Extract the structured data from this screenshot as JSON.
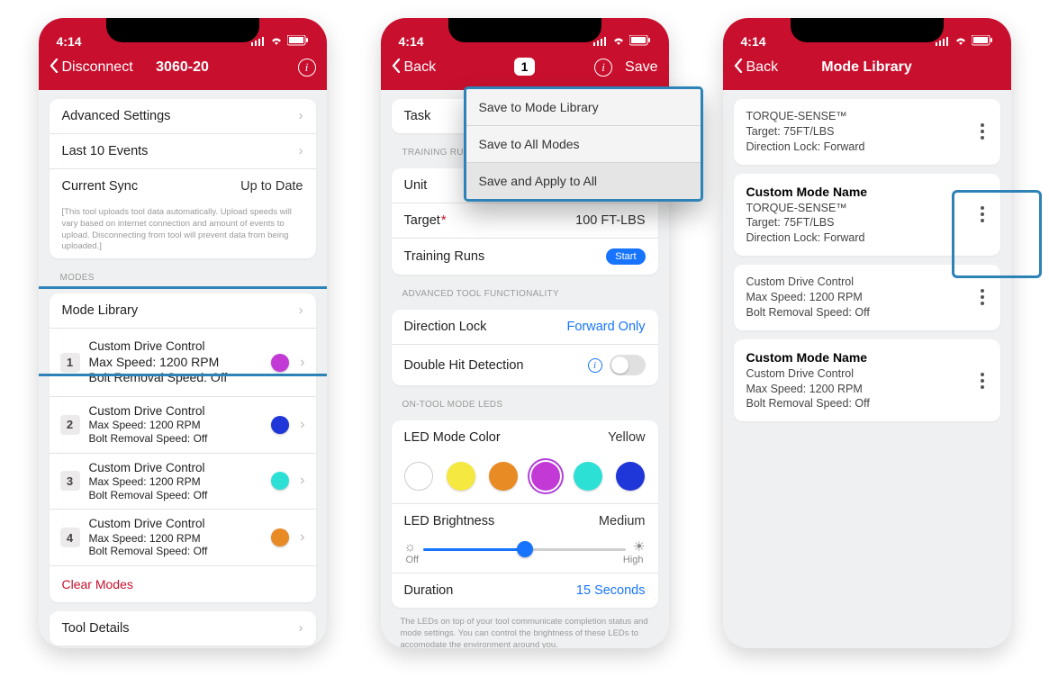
{
  "status_time": "4:14",
  "screen1": {
    "nav_left": "Disconnect",
    "nav_title": "3060-20",
    "rows": {
      "advanced": "Advanced Settings",
      "events": "Last 10 Events",
      "sync": "Current Sync",
      "sync_value": "Up to Date"
    },
    "fineprint": "[This tool uploads tool data automatically. Upload speeds will vary based on internet connection and amount of events to upload. Disconnecting from tool will prevent data from being uploaded.]",
    "modes_header": "MODES",
    "mode_library": "Mode Library",
    "modes": [
      {
        "n": "1",
        "l1": "Custom Drive Control",
        "l2": "Max Speed: 1200 RPM",
        "l3": "Bolt Removal Speed: Off",
        "color": "#c239d6"
      },
      {
        "n": "2",
        "l1": "Custom Drive Control",
        "l2": "Max Speed: 1200 RPM",
        "l3": "Bolt Removal Speed: Off",
        "color": "#1f36d8"
      },
      {
        "n": "3",
        "l1": "Custom Drive Control",
        "l2": "Max Speed: 1200 RPM",
        "l3": "Bolt Removal Speed: Off",
        "color": "#2de0d6"
      },
      {
        "n": "4",
        "l1": "Custom Drive Control",
        "l2": "Max Speed: 1200 RPM",
        "l3": "Bolt Removal Speed: Off",
        "color": "#e88b24"
      }
    ],
    "clear": "Clear Modes",
    "tool_details": "Tool Details"
  },
  "screen2": {
    "nav_left": "Back",
    "nav_badge": "1",
    "nav_right": "Save",
    "popover": [
      "Save to Mode Library",
      "Save to All Modes",
      "Save and Apply to All"
    ],
    "task_label": "Task",
    "training_header": "TRAINING RUN",
    "unit_label": "Unit",
    "target_label": "Target",
    "target_value": "100 FT-LBS",
    "training_label": "Training Runs",
    "training_btn": "Start",
    "func_header": "ADVANCED TOOL FUNCTIONALITY",
    "dirlock_label": "Direction Lock",
    "dirlock_value": "Forward Only",
    "dblhit_label": "Double Hit Detection",
    "led_header": "ON-TOOL MODE LEDS",
    "ledcolor_label": "LED Mode Color",
    "ledcolor_value": "Yellow",
    "swatches": [
      "outline",
      "#f4e841",
      "#e88b24",
      "#c239d6",
      "#2de0d6",
      "#1f36d8"
    ],
    "swatch_selected": 3,
    "brightness_label": "LED Brightness",
    "brightness_value": "Medium",
    "brightness_low": "Off",
    "brightness_high": "High",
    "duration_label": "Duration",
    "duration_value": "15 Seconds",
    "led_fineprint": "The LEDs on top of your tool communicate completion status and mode settings.  You can control the brightness of these LEDs to accomodate the environment around you."
  },
  "screen3": {
    "nav_left": "Back",
    "nav_title": "Mode Library",
    "cards": [
      {
        "title": "",
        "l1": "TORQUE-SENSE™",
        "l2": "Target: 75FT/LBS",
        "l3": "Direction Lock: Forward"
      },
      {
        "title": "Custom Mode Name",
        "l1": "TORQUE-SENSE™",
        "l2": "Target: 75FT/LBS",
        "l3": "Direction Lock: Forward"
      },
      {
        "title": "",
        "l1": "Custom Drive Control",
        "l2": "Max Speed: 1200 RPM",
        "l3": "Bolt Removal Speed: Off"
      },
      {
        "title": "Custom Mode Name",
        "l1": "Custom Drive Control",
        "l2": "Max Speed: 1200 RPM",
        "l3": "Bolt Removal Speed: Off"
      }
    ]
  }
}
